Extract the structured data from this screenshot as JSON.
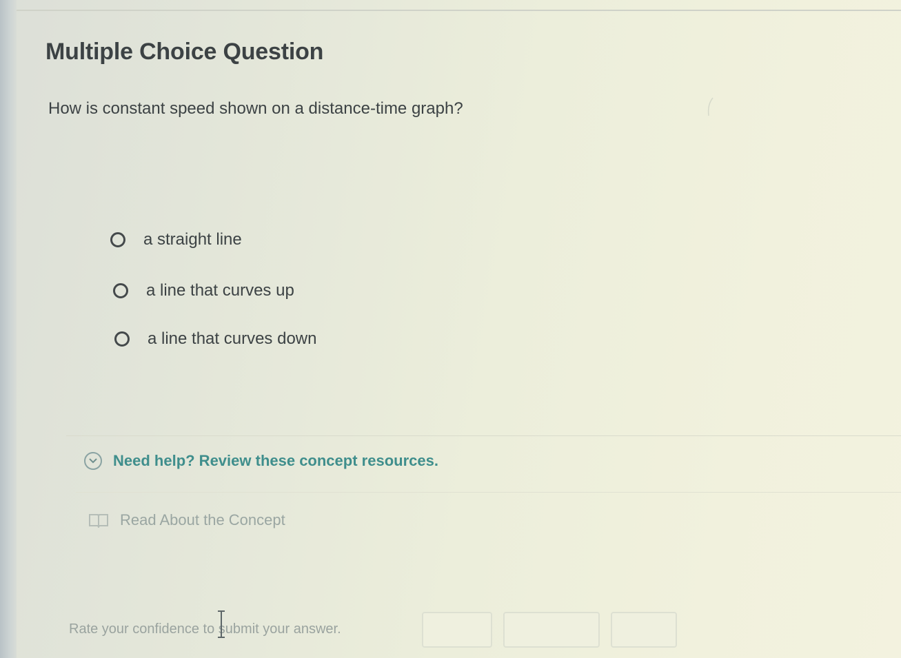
{
  "question": {
    "heading": "Multiple Choice Question",
    "prompt": "How is constant speed shown on a distance-time graph?",
    "choices": [
      {
        "label": "a straight line"
      },
      {
        "label": "a line that curves up"
      },
      {
        "label": "a line that curves down"
      }
    ]
  },
  "help": {
    "toggle_label": "Need help? Review these concept resources.",
    "resource_label": "Read About the Concept"
  },
  "confidence": {
    "prompt": "Rate your confidence to submit your answer.",
    "buttons": [
      "",
      "",
      ""
    ]
  },
  "colors": {
    "accent_teal": "#3f8e8c",
    "text_dark": "#3c4244",
    "muted_text": "#9aa6a2"
  },
  "icons": {
    "help_toggle": "chevron-down-circle-icon",
    "resource": "book-icon",
    "radio": "radio-unchecked-icon"
  }
}
